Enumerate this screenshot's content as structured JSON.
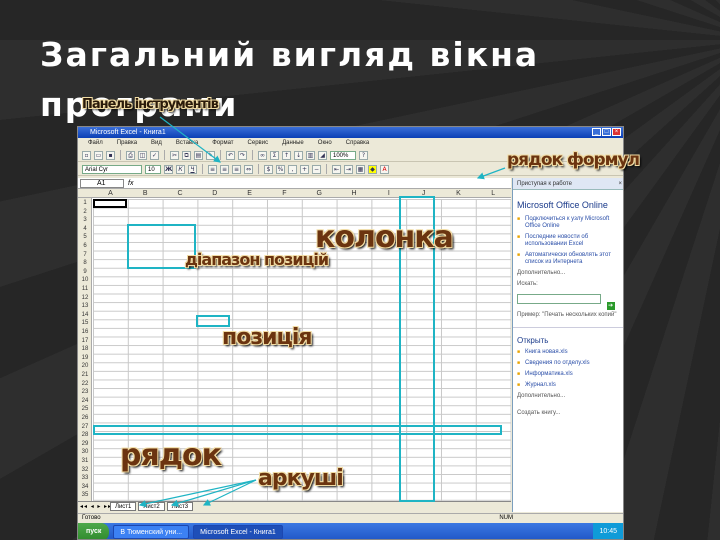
{
  "slide": {
    "title": "Загальний вигляд вікна програми"
  },
  "excel": {
    "window_title": "Microsoft Excel - Книга1",
    "menu": [
      "Файл",
      "Правка",
      "Вид",
      "Вставка",
      "Формат",
      "Сервис",
      "Данные",
      "Окно",
      "Справка"
    ],
    "font_name": "Arial Cyr",
    "font_size": "10",
    "zoom": "100%",
    "name_box": "A1",
    "fx_label": "fx",
    "columns": [
      "A",
      "B",
      "C",
      "D",
      "E",
      "F",
      "G",
      "H",
      "I",
      "J",
      "K",
      "L"
    ],
    "rows": [
      "1",
      "2",
      "3",
      "4",
      "5",
      "6",
      "7",
      "8",
      "9",
      "10",
      "11",
      "12",
      "13",
      "14",
      "15",
      "16",
      "17",
      "18",
      "19",
      "20",
      "21",
      "22",
      "23",
      "24",
      "25",
      "26",
      "27",
      "28",
      "29",
      "30",
      "31",
      "32",
      "33",
      "34",
      "35"
    ],
    "sheet_nav": "◂◂ ◂ ▸ ▸▸",
    "sheets": [
      "Лист1",
      "Лист2",
      "Лист3"
    ],
    "status_left": "Готово",
    "status_num": "NUM"
  },
  "taskpane": {
    "header": "Приступая к работе",
    "close": "×",
    "section_title": "Microsoft Office Online",
    "links": [
      "Подключиться к узлу Microsoft Office Online",
      "Последние новости об использовании Excel",
      "Автоматически обновлять этот список из Интернета"
    ],
    "more": "Дополнительно...",
    "search_label": "Искать:",
    "search_example": "Пример: \"Печать нескольких копий\"",
    "go": "➔",
    "open_title": "Открыть",
    "files": [
      "Книга новая.xls",
      "Сведения по отделу.xls",
      "Информатика.xls",
      "Журнал.xls"
    ],
    "more_files": "Дополнительно...",
    "create": "Создать книгу..."
  },
  "taskbar": {
    "start": "пуск",
    "items": [
      "В Тюменский уни...",
      "Microsoft Excel - Книга1"
    ],
    "clock": "10:45"
  },
  "annotations": {
    "toolbars": "Панель інструментів",
    "formula_bar": "рядок формул",
    "column": "колонка",
    "range": "діапазон позицій",
    "cell": "позиція",
    "row": "рядок",
    "sheets": "аркуші"
  },
  "colors": {
    "highlight": "#1fb4c4",
    "annotation_text": "#6b3410",
    "slide_bg": "#2b2b2b"
  }
}
